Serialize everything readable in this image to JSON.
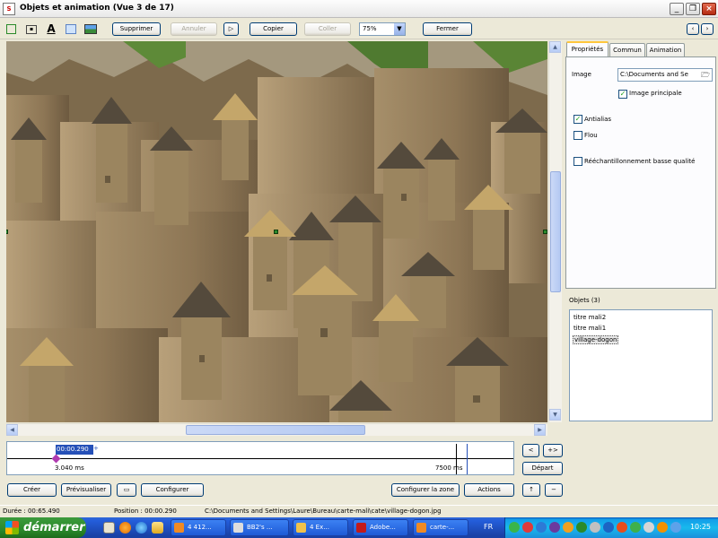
{
  "window": {
    "title": "Objets et animation  (Vue 3 de 17)",
    "minimize": "_",
    "maximize": "❐",
    "close": "×"
  },
  "toolbar": {
    "supprimer": "Supprimer",
    "annuler": "Annuler",
    "redo": "▷",
    "copier": "Copier",
    "coller": "Coller",
    "zoom": "75%",
    "fermer": "Fermer",
    "prev": "‹",
    "next": "›"
  },
  "tabs": [
    "Propriétés",
    "Commun",
    "Animation"
  ],
  "properties": {
    "image_label": "Image",
    "image_path": "C:\\Documents and Se",
    "image_principale": "Image principale",
    "antialias": "Antialias",
    "flou": "Flou",
    "reechantillonnement": "Rééchantillonnement basse qualité",
    "image_principale_checked": true,
    "antialias_checked": true,
    "flou_checked": false,
    "reechantillonnement_checked": false
  },
  "objects": {
    "label": "Objets (3)",
    "items": [
      "titre mali2",
      "titre mali1",
      "village-dogon"
    ],
    "selected_index": 2
  },
  "timeline": {
    "current_time": "00:00.290",
    "start_time": "3.040 ms",
    "end_time": "7500 ms"
  },
  "timeline_buttons": {
    "prev": "<",
    "add": "+>",
    "depart": "Départ"
  },
  "bottom_buttons": {
    "creer": "Créer",
    "previsualiser": "Prévisualiser",
    "configurer": "Configurer",
    "configurer_la_zone": "Configurer la zone",
    "actions": "Actions",
    "up": "↑",
    "minus": "−"
  },
  "status": {
    "duree": "Durée : 00:65.490",
    "position": "Position : 00:00.290",
    "path": "C:\\Documents and Settings\\Laure\\Bureau\\carte-mali\\cate\\village-dogon.jpg"
  },
  "taskbar": {
    "start": "démarrer",
    "tasks": [
      "4 412...",
      "BB2's ...",
      "4 Ex...",
      "Adobe...",
      "carte-..."
    ],
    "lang": "FR",
    "clock": "10:25"
  }
}
